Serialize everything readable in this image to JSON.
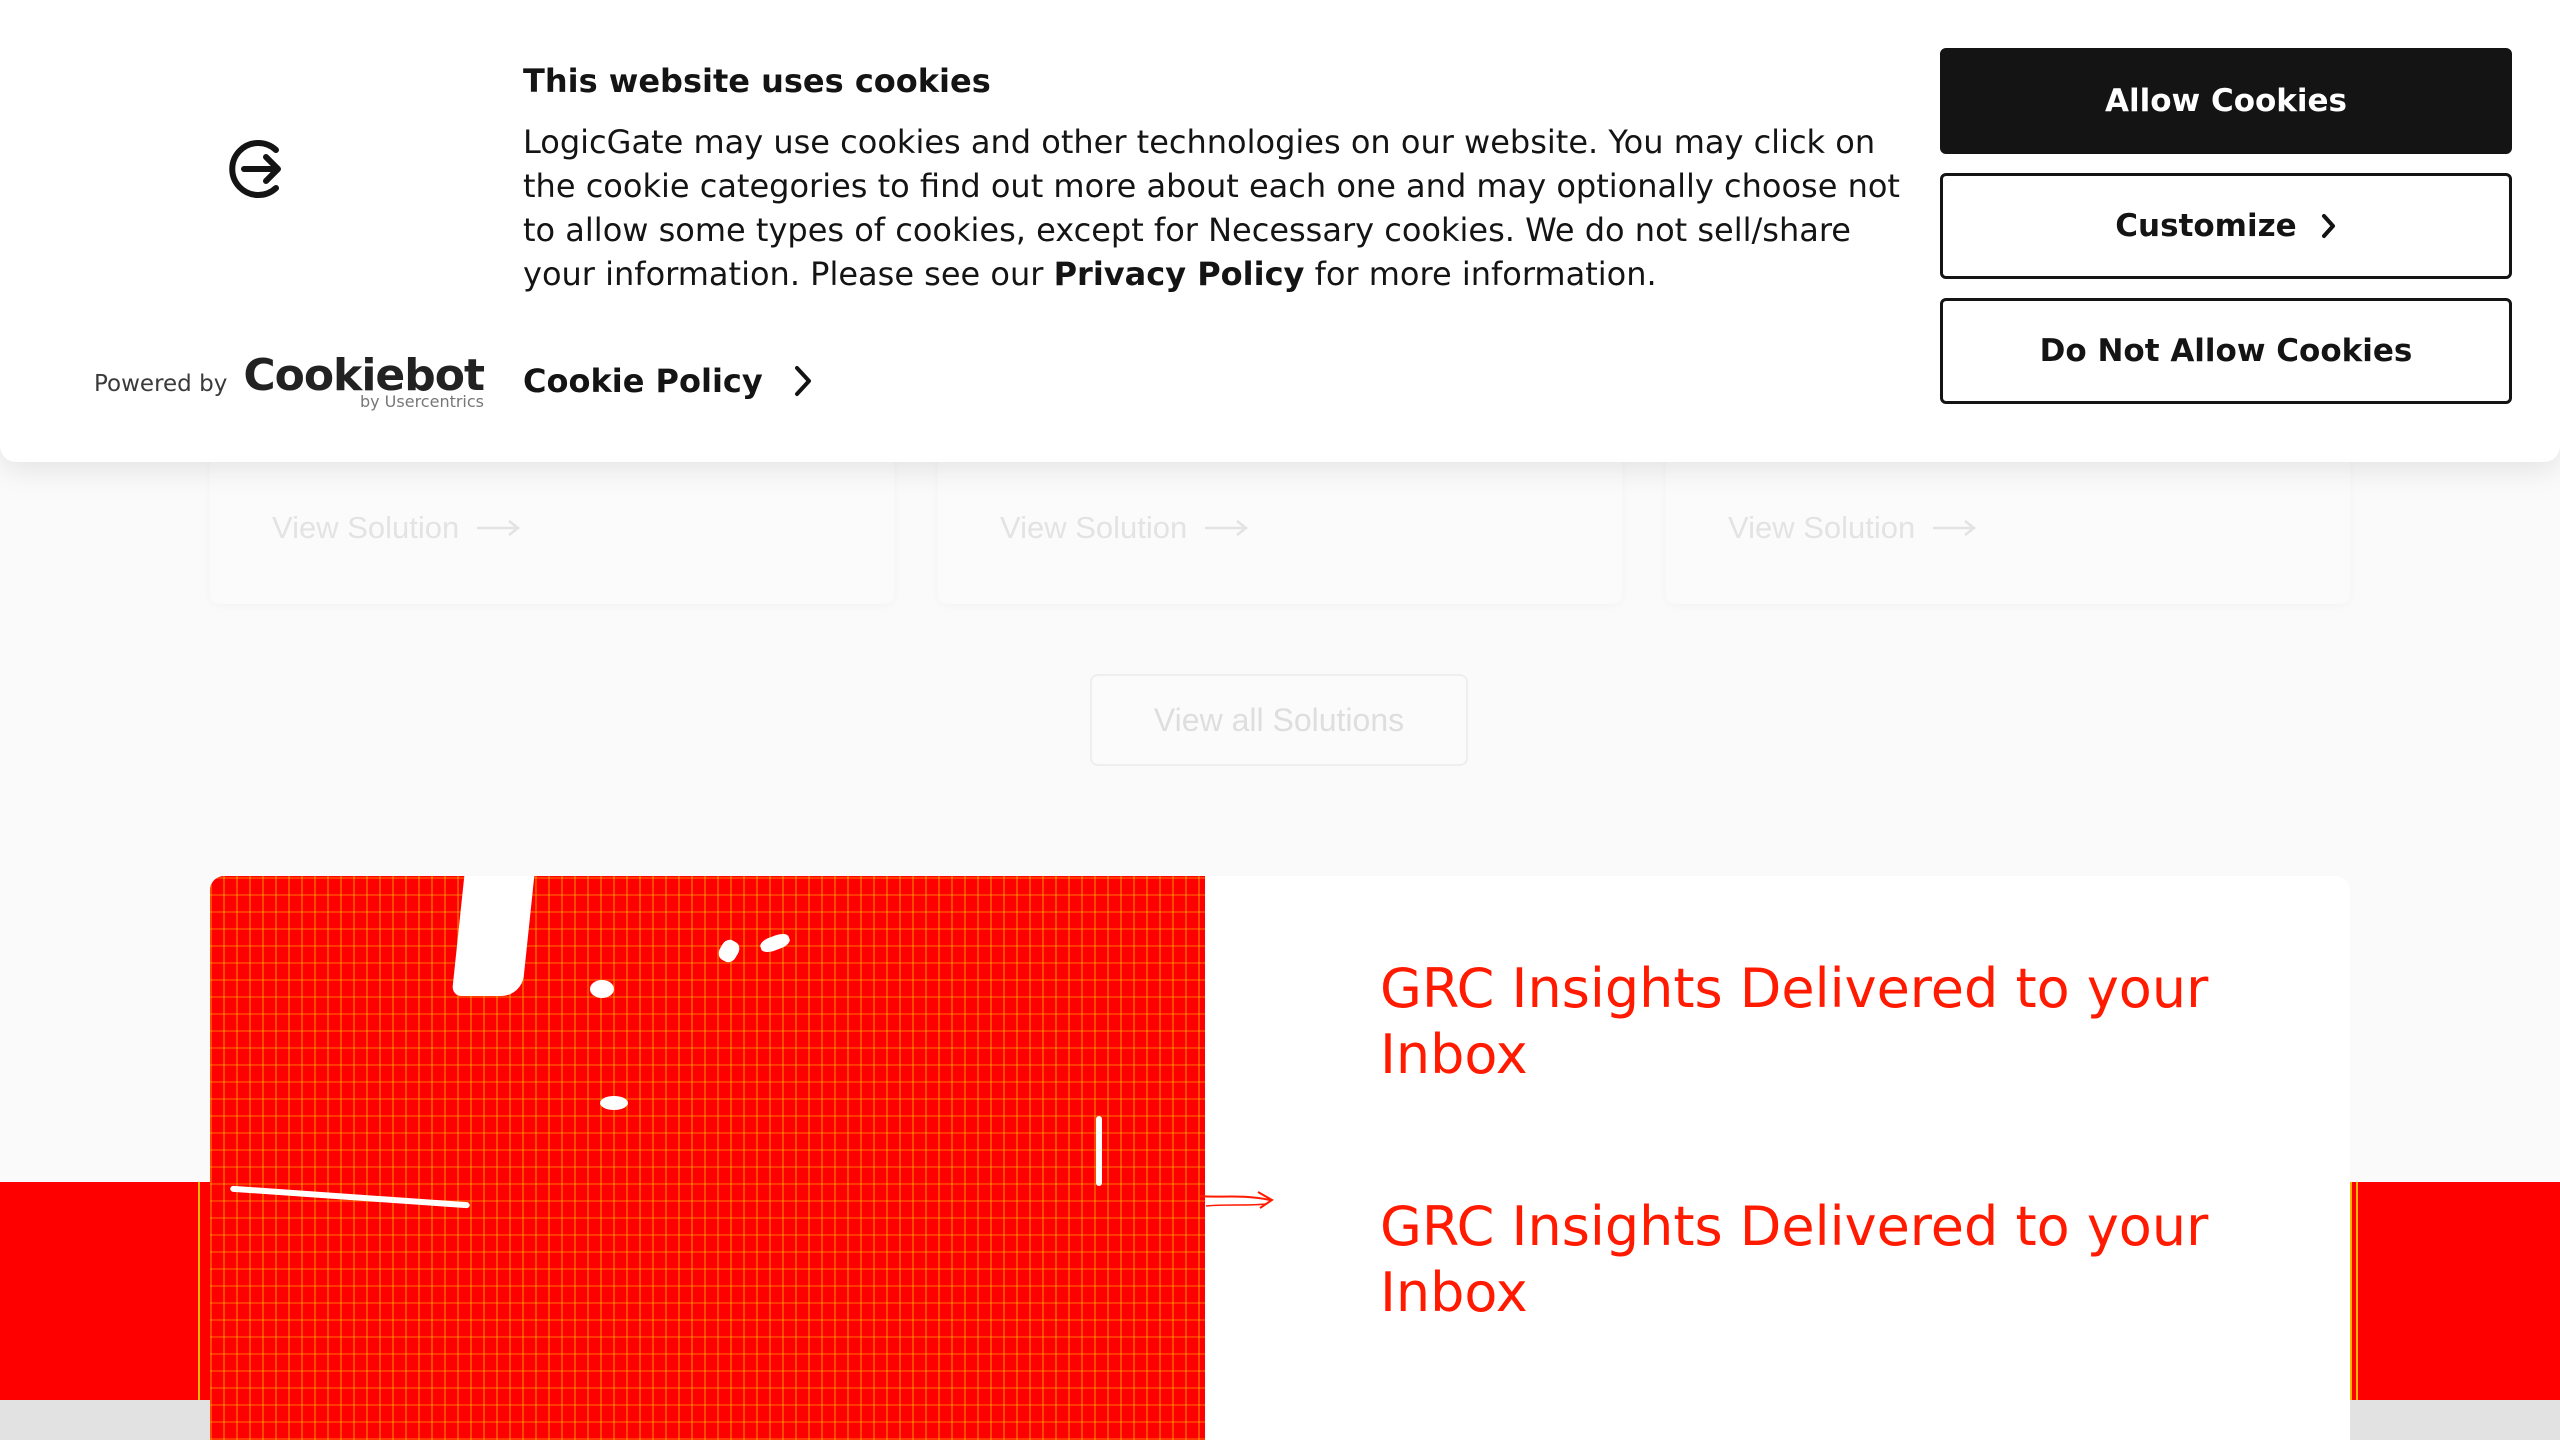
{
  "cookie_banner": {
    "title": "This website uses cookies",
    "body_before_link": "LogicGate may use cookies and other technologies on our website. You may click on the cookie categories to find out more about each one and may optionally choose not to allow some types of cookies, except for Necessary cookies.  We do not sell/share your information. Please see our ",
    "privacy_link": "Privacy Policy",
    "body_after_link": " for more information.",
    "cookie_policy_link": "Cookie Policy",
    "powered_by": "Powered by",
    "cookiebot_brand": "Cookiebot",
    "cookiebot_sub": "by Usercentrics",
    "buttons": {
      "allow": "Allow Cookies",
      "customize": "Customize",
      "deny": "Do Not Allow Cookies"
    },
    "icons": [
      "logicgate-logo-icon",
      "chevron-right-icon",
      "cookiebot-logo"
    ]
  },
  "solutions": {
    "cards": [
      {
        "link": "View Solution"
      },
      {
        "link": "View Solution"
      },
      {
        "link": "View Solution"
      }
    ],
    "view_all": "View all Solutions"
  },
  "newsletter": {
    "heading_1": "GRC Insights Delivered to your Inbox",
    "heading_2": "GRC Insights Delivered to your Inbox"
  },
  "colors": {
    "accent_red": "#ff0000",
    "heading_red": "#ff1a00",
    "banner_text": "#141414"
  }
}
